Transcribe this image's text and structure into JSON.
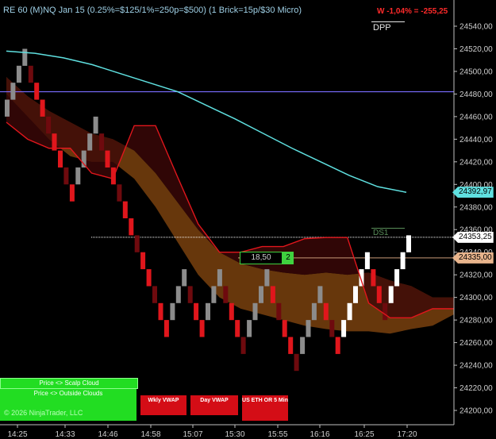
{
  "header": {
    "instrument_title": "RE 60 (M)NQ Jan 15 (0.25%=$125/1%=250p=$500) (1 Brick=15p/$30 Micro)",
    "pnl": "W -1,04% = -255,25",
    "dpp_label": "DPP",
    "ds1_label": "DS1"
  },
  "order_marker": {
    "price": "18,50",
    "qty": "2"
  },
  "price_axis": {
    "ticks": [
      "24540,00",
      "24520,00",
      "24500,00",
      "24480,00",
      "24460,00",
      "24440,00",
      "24420,00",
      "24400,00",
      "24380,00",
      "24360,00",
      "24340,00",
      "24320,00",
      "24300,00",
      "24280,00",
      "24260,00",
      "24240,00",
      "24220,00",
      "24200,00"
    ],
    "tags": [
      {
        "label": "24392,97",
        "price": 24392.97,
        "bg": "#5fe0e0",
        "fg": "#000000"
      },
      {
        "label": "24353,25",
        "price": 24353.25,
        "bg": "#ffffff",
        "fg": "#000000"
      },
      {
        "label": "24335,00",
        "price": 24335.0,
        "bg": "#e8b48c",
        "fg": "#000000"
      }
    ]
  },
  "time_axis": {
    "ticks": [
      "14:25",
      "14:33",
      "14:46",
      "14:58",
      "15:07",
      "15:30",
      "15:55",
      "16:16",
      "16:25",
      "17:20"
    ]
  },
  "buttons": {
    "scalp_cloud": "Price <> Scalp Cloud",
    "outside_clouds": "Price <> Outside Clouds",
    "copyright": "© 2026 NinjaTrader, LLC",
    "wkly_vwap": "Wkly VWAP",
    "day_vwap": "Day VWAP",
    "us_eth": "US ETH OR 5 Min"
  },
  "colors": {
    "background": "#000000",
    "brick_up": "#ffffff",
    "brick_up_old": "#8c8c8c",
    "brick_down": "#e0161c",
    "brick_down_old": "#6e0a0e",
    "cyan_line": "#5fe0e0",
    "red_line": "#e0161c",
    "purple_line": "#7a6cff",
    "cloud_orange": "#8a4a10",
    "cloud_red": "#3c0808"
  },
  "chart_data": {
    "type": "renko",
    "brick_size_points": 15,
    "price_range": [
      24190,
      24550
    ],
    "levels": {
      "purple_hline": 24482,
      "white_dotted_hline": 24353.25,
      "order_price": 24335
    },
    "bricks": [
      {
        "dir": "up",
        "low": 24460
      },
      {
        "dir": "up",
        "low": 24475
      },
      {
        "dir": "up",
        "low": 24490
      },
      {
        "dir": "up",
        "low": 24505
      },
      {
        "dir": "down",
        "low": 24490
      },
      {
        "dir": "down",
        "low": 24475
      },
      {
        "dir": "down",
        "low": 24460
      },
      {
        "dir": "down",
        "low": 24445
      },
      {
        "dir": "down",
        "low": 24430
      },
      {
        "dir": "down",
        "low": 24415
      },
      {
        "dir": "down",
        "low": 24400
      },
      {
        "dir": "down",
        "low": 24385
      },
      {
        "dir": "up",
        "low": 24400
      },
      {
        "dir": "up",
        "low": 24415
      },
      {
        "dir": "up",
        "low": 24430
      },
      {
        "dir": "up",
        "low": 24445
      },
      {
        "dir": "down",
        "low": 24430
      },
      {
        "dir": "down",
        "low": 24415
      },
      {
        "dir": "down",
        "low": 24400
      },
      {
        "dir": "down",
        "low": 24385
      },
      {
        "dir": "down",
        "low": 24370
      },
      {
        "dir": "down",
        "low": 24355
      },
      {
        "dir": "down",
        "low": 24340
      },
      {
        "dir": "down",
        "low": 24325
      },
      {
        "dir": "down",
        "low": 24310
      },
      {
        "dir": "down",
        "low": 24295
      },
      {
        "dir": "down",
        "low": 24280
      },
      {
        "dir": "down",
        "low": 24265
      },
      {
        "dir": "up",
        "low": 24280
      },
      {
        "dir": "up",
        "low": 24295
      },
      {
        "dir": "up",
        "low": 24310
      },
      {
        "dir": "down",
        "low": 24295
      },
      {
        "dir": "down",
        "low": 24280
      },
      {
        "dir": "down",
        "low": 24265
      },
      {
        "dir": "up",
        "low": 24280
      },
      {
        "dir": "up",
        "low": 24295
      },
      {
        "dir": "up",
        "low": 24310
      },
      {
        "dir": "down",
        "low": 24295
      },
      {
        "dir": "down",
        "low": 24280
      },
      {
        "dir": "down",
        "low": 24265
      },
      {
        "dir": "down",
        "low": 24250
      },
      {
        "dir": "up",
        "low": 24265
      },
      {
        "dir": "up",
        "low": 24280
      },
      {
        "dir": "up",
        "low": 24295
      },
      {
        "dir": "up",
        "low": 24310
      },
      {
        "dir": "down",
        "low": 24295
      },
      {
        "dir": "down",
        "low": 24280
      },
      {
        "dir": "down",
        "low": 24265
      },
      {
        "dir": "down",
        "low": 24250
      },
      {
        "dir": "down",
        "low": 24235
      },
      {
        "dir": "up",
        "low": 24250
      },
      {
        "dir": "up",
        "low": 24265
      },
      {
        "dir": "up",
        "low": 24280
      },
      {
        "dir": "up",
        "low": 24295
      },
      {
        "dir": "down",
        "low": 24280
      },
      {
        "dir": "down",
        "low": 24265
      },
      {
        "dir": "down",
        "low": 24250
      },
      {
        "dir": "up",
        "low": 24265
      },
      {
        "dir": "up",
        "low": 24280
      },
      {
        "dir": "up",
        "low": 24295
      },
      {
        "dir": "up",
        "low": 24310
      },
      {
        "dir": "up",
        "low": 24325
      },
      {
        "dir": "down",
        "low": 24310
      },
      {
        "dir": "down",
        "low": 24295
      },
      {
        "dir": "down",
        "low": 24280
      },
      {
        "dir": "up",
        "low": 24295
      },
      {
        "dir": "up",
        "low": 24310
      },
      {
        "dir": "up",
        "low": 24325
      },
      {
        "dir": "up",
        "low": 24340
      }
    ],
    "cyan_line": [
      24518,
      24516,
      24512,
      24506,
      24498,
      24490,
      24482,
      24470,
      24458,
      24445,
      24432,
      24420,
      24408,
      24398,
      24393
    ],
    "red_line": [
      24455,
      24440,
      24432,
      24432,
      24410,
      24405,
      24452,
      24452,
      24408,
      24365,
      24340,
      24340,
      24345,
      24345,
      24352,
      24353,
      24353,
      24295,
      24282,
      24282,
      24290,
      24290
    ],
    "cloud_top": [
      24495,
      24478,
      24465,
      24455,
      24445,
      24440,
      24430,
      24410,
      24385,
      24360,
      24340,
      24330,
      24325,
      24322,
      24320,
      24322,
      24320,
      24322,
      24315,
      24310,
      24300,
      24300
    ],
    "cloud_bottom": [
      24480,
      24460,
      24440,
      24425,
      24420,
      24420,
      24405,
      24380,
      24350,
      24320,
      24300,
      24290,
      24285,
      24280,
      24275,
      24272,
      24270,
      24270,
      24268,
      24272,
      24275,
      24285
    ]
  }
}
